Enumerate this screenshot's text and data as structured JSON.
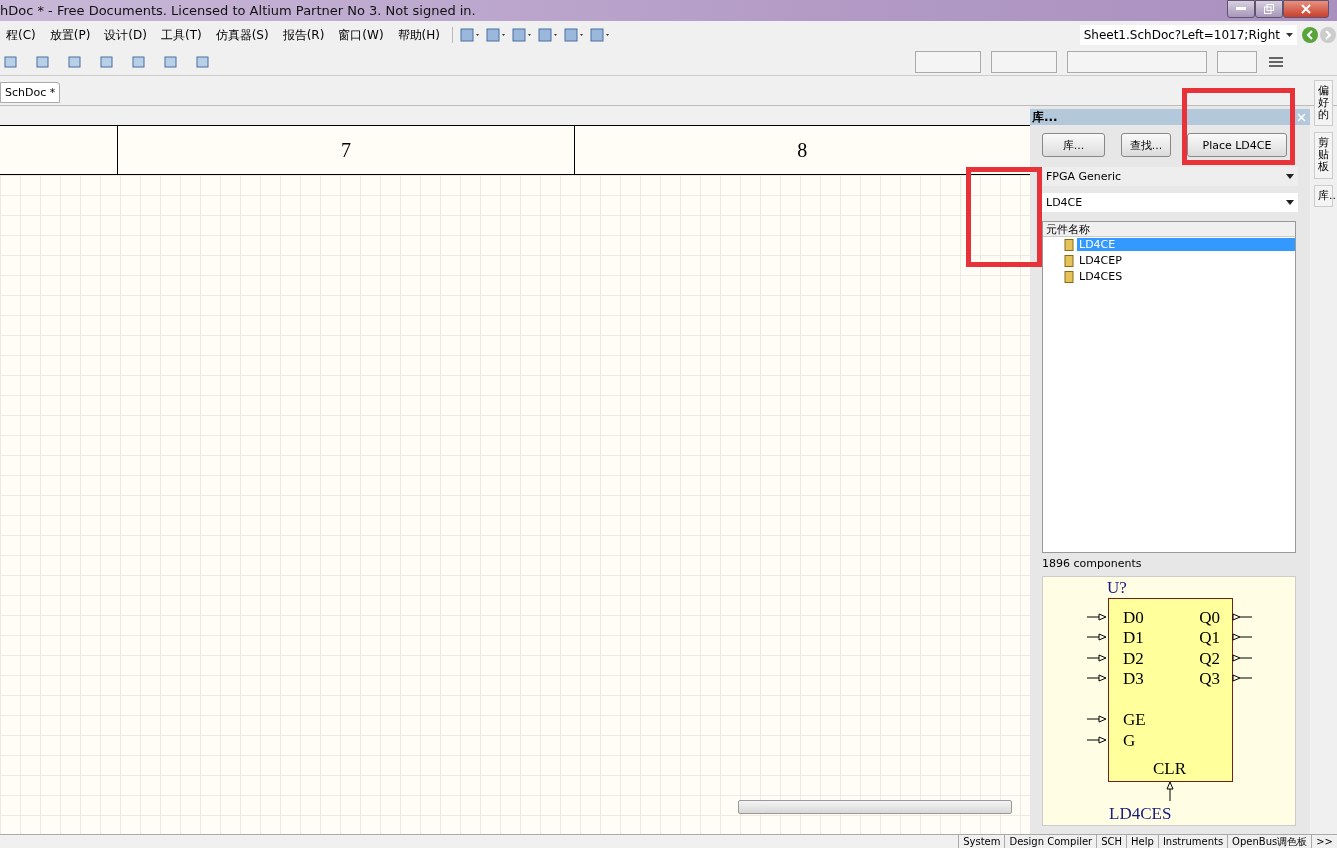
{
  "window": {
    "title": "hDoc * - Free Documents. Licensed to Altium Partner No 3. Not signed in."
  },
  "menu": [
    "程(C)",
    "放置(P)",
    "设计(D)",
    "工具(T)",
    "仿真器(S)",
    "报告(R)",
    "窗口(W)",
    "帮助(H)"
  ],
  "address": "Sheet1.SchDoc?Left=1017;Right",
  "document_tabs": [
    {
      "label": "SchDoc *",
      "selected": true
    }
  ],
  "sheet": {
    "zones": [
      "7",
      "8"
    ]
  },
  "library_panel": {
    "title": "库...",
    "buttons": [
      "库...",
      "查找...",
      "Place LD4CE"
    ],
    "library": "FPGA Generic",
    "filter": "LD4CE",
    "column": "元件名称",
    "components": [
      {
        "name": "LD4CE",
        "selected": true
      },
      {
        "name": "LD4CEP",
        "selected": false
      },
      {
        "name": "LD4CES",
        "selected": false
      }
    ],
    "count": "1896 components",
    "preview": {
      "designator": "U?",
      "left_pins": [
        "D0",
        "D1",
        "D2",
        "D3"
      ],
      "control_pins": [
        "GE",
        "G"
      ],
      "right_pins": [
        "Q0",
        "Q1",
        "Q2",
        "Q3"
      ],
      "bottom_pin": "CLR",
      "name": "LD4CES"
    }
  },
  "side_tabs": [
    "偏好的",
    "剪贴板",
    "库..."
  ],
  "status_tabs": [
    "System",
    "Design Compiler",
    "SCH",
    "Help",
    "Instruments",
    "OpenBus调色板",
    ">>"
  ]
}
